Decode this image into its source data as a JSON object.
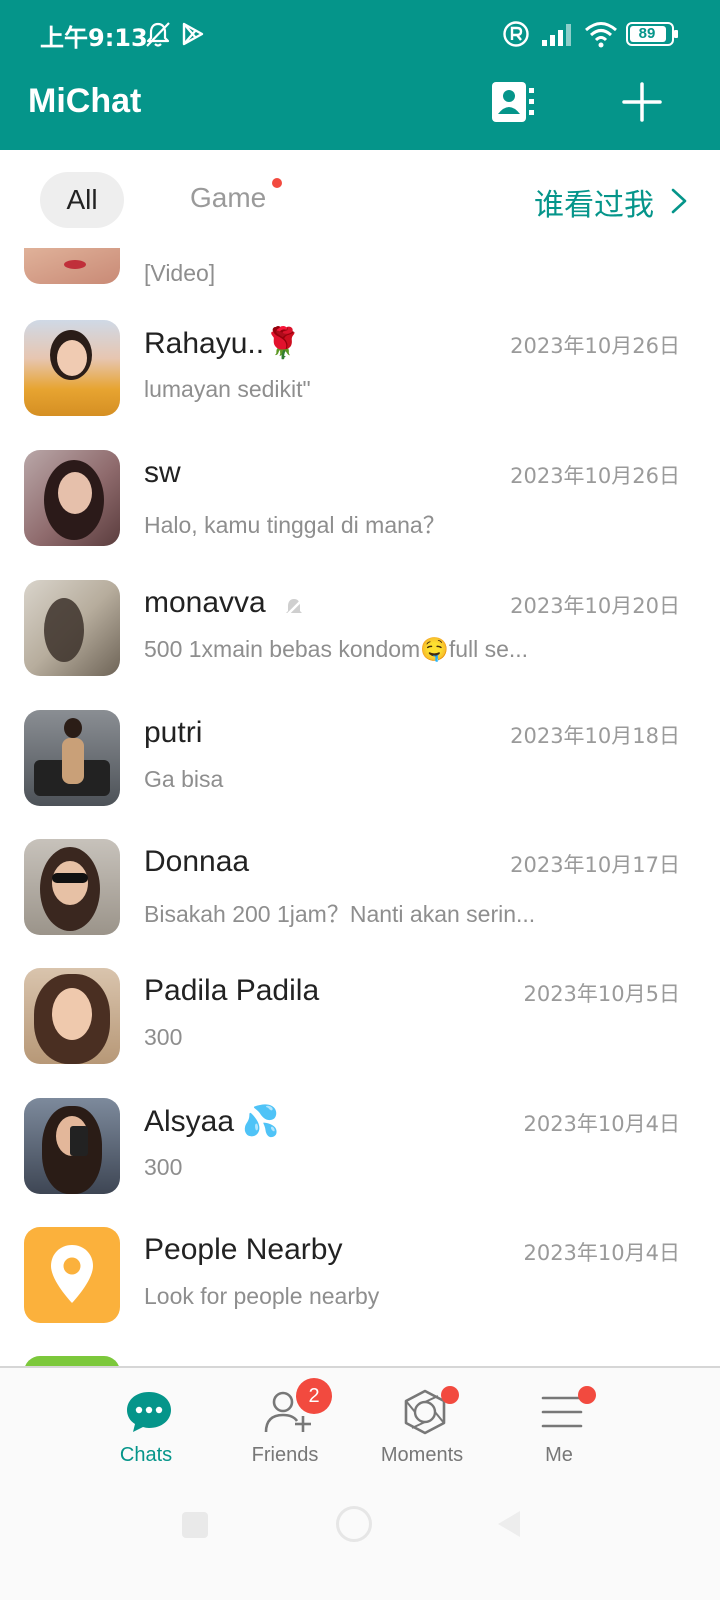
{
  "status_bar": {
    "time": "上午9:13",
    "battery": "89",
    "icons": [
      "bell-muted-icon",
      "play-store-icon",
      "registered-icon",
      "signal-icon",
      "wifi-icon",
      "battery-icon"
    ]
  },
  "header": {
    "title": "MiChat",
    "actions": [
      "contacts-icon",
      "plus-icon"
    ],
    "background": "#05958a"
  },
  "filters": {
    "all_label": "All",
    "game_label": "Game",
    "who_viewed_label": "谁看过我"
  },
  "chats": [
    {
      "name": "",
      "preview": "[Video]",
      "date": ""
    },
    {
      "name": "Rahayu..🌹",
      "preview": "lumayan sedikit\"",
      "date": "2023年10月26日"
    },
    {
      "name": "sw",
      "preview": "Halo, kamu tinggal di mana？",
      "date": "2023年10月26日"
    },
    {
      "name": "monavva",
      "preview": "500 1xmain bebas kondom🤤full se...",
      "date": "2023年10月20日",
      "muted": true
    },
    {
      "name": "putri",
      "preview": " Ga bisa",
      "date": "2023年10月18日"
    },
    {
      "name": "Donnaa",
      "preview": "Bisakah 200 1jam？Nanti akan serin...",
      "date": "2023年10月17日"
    },
    {
      "name": "Padila Padila",
      "preview": "300",
      "date": "2023年10月5日"
    },
    {
      "name": "Alsyaa 💦",
      "preview": "300",
      "date": "2023年10月4日"
    },
    {
      "name": "People Nearby",
      "preview": "Look for people nearby",
      "date": "2023年10月4日"
    }
  ],
  "bottom_nav": {
    "items": [
      {
        "label": "Chats",
        "icon": "chat-bubble-icon",
        "active": true
      },
      {
        "label": "Friends",
        "icon": "add-friend-icon",
        "badge": "2"
      },
      {
        "label": "Moments",
        "icon": "camera-aperture-icon"
      },
      {
        "label": "Me",
        "icon": "menu-icon"
      }
    ],
    "accent": "#05958a",
    "badge_color": "#f24a3f"
  }
}
